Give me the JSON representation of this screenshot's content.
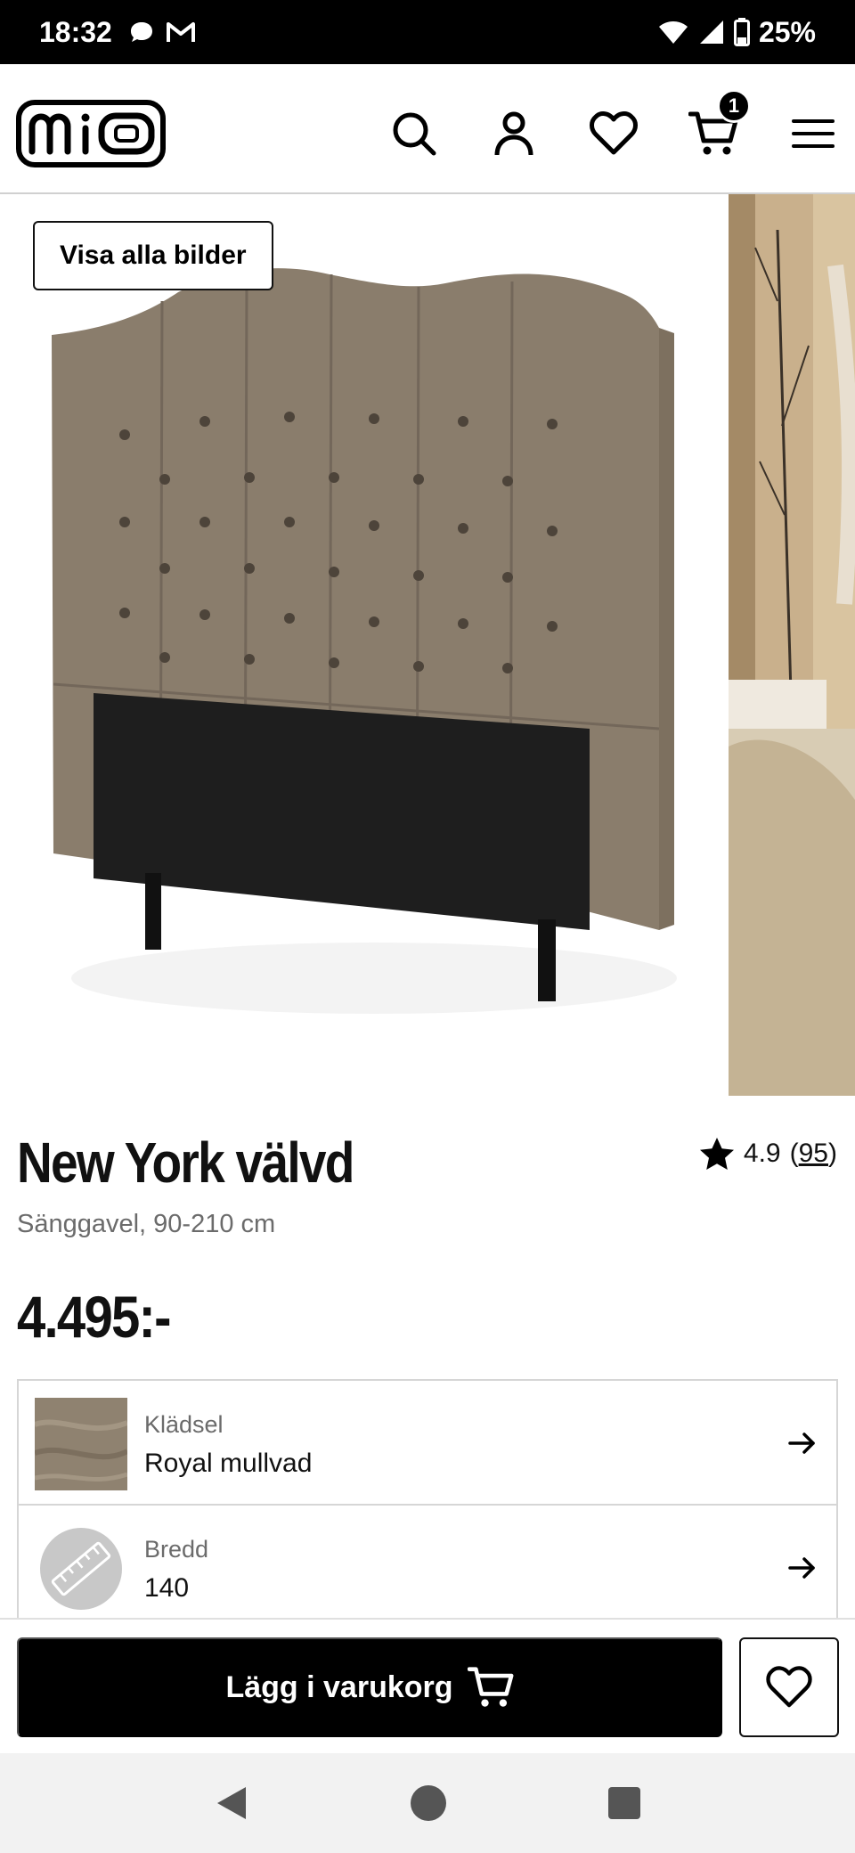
{
  "status_bar": {
    "time": "18:32",
    "battery": "25%",
    "icons": [
      "chat-icon",
      "gmail-icon",
      "wifi-icon",
      "signal-icon",
      "battery-icon"
    ]
  },
  "header": {
    "logo_text": "mio",
    "icons": [
      "search-icon",
      "account-icon",
      "heart-icon",
      "cart-icon",
      "menu-icon"
    ],
    "cart_count": "1"
  },
  "gallery": {
    "show_all_label": "Visa alla bilder"
  },
  "product": {
    "title": "New York välvd",
    "subtitle": "Sänggavel, 90-210 cm",
    "price": "4.495:-",
    "rating": "4.9",
    "rating_open": "(",
    "rating_count": "95",
    "rating_close": ")"
  },
  "options": [
    {
      "label": "Klädsel",
      "value": "Royal mullvad"
    },
    {
      "label": "Bredd",
      "value": "140"
    }
  ],
  "actions": {
    "add_to_cart_label": "Lägg i varukorg"
  },
  "colors": {
    "fabric": "#8a7d6c",
    "panel": "#1e1e1e",
    "accent": "#000000"
  }
}
